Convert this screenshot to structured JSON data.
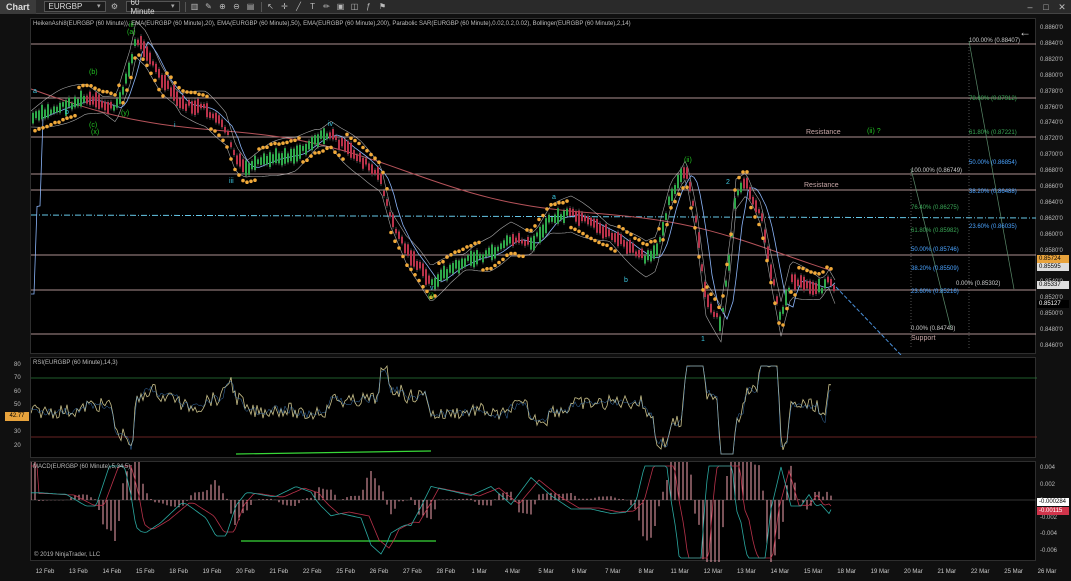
{
  "toolbar": {
    "title": "Chart",
    "instrument": "EURGBP",
    "period": "60 Minute",
    "icons": [
      "bar-type-icon",
      "draw-tools-icon",
      "zoom-in-icon",
      "zoom-out-icon",
      "properties-icon",
      "cursor-icon",
      "crosshair-icon",
      "line-tool-icon",
      "text-tool-icon",
      "pencil-icon",
      "data-box-icon",
      "screenshot-icon",
      "indicators-icon",
      "strategies-icon"
    ],
    "window_controls": [
      "minimize-icon",
      "maximize-icon",
      "close-icon"
    ]
  },
  "price_panel": {
    "indicator_label": "HeikenAshi8(EURGBP (60 Minute)), EMA(EURGBP (60 Minute),20), EMA(EURGBP (60 Minute),50), EMA(EURGBP (60 Minute),200), Parabolic SAR(EURGBP (60 Minute),0.02,0.2,0.02), Bollinger(EURGBP (60 Minute),2,14)",
    "axis_ticks": [
      "0.8860'0",
      "0.8840'0",
      "0.8820'0",
      "0.8800'0",
      "0.8780'0",
      "0.8760'0",
      "0.8740'0",
      "0.8720'0",
      "0.8700'0",
      "0.8680'0",
      "0.8660'0",
      "0.8640'0",
      "0.8620'0",
      "0.8600'0",
      "0.8580'0",
      "0.8560'0",
      "0.8540'0",
      "0.8520'0",
      "0.8500'0",
      "0.8480'0",
      "0.8460'0"
    ],
    "axis_badges": [
      {
        "text": "0.85724",
        "bg": "#e8a33c",
        "fg": "#000000"
      },
      {
        "text": "0.85595",
        "bg": "#dddddd",
        "fg": "#000000"
      },
      {
        "text": "0.85337",
        "bg": "#dddddd",
        "fg": "#000000"
      },
      {
        "text": "0.85127",
        "bg": "#000000",
        "fg": "#ffffff"
      }
    ],
    "fib_labels_right": [
      "100.00% (0.88407)",
      "78.60% (0.87912)",
      "61.80% (0.87221)",
      "50.00% (0.86854)",
      "38.20% (0.86488)",
      "23.60% (0.86035)"
    ],
    "fib_labels_mid": [
      "100.00% (0.86749)",
      "76.40% (0.86275)",
      "61.80% (0.85982)",
      "50.00% (0.85746)",
      "38.20% (0.85509)",
      "23.60% (0.85216)",
      "0.00% (0.84743)",
      "0.00% (0.85302)"
    ],
    "annotations": {
      "resistance_1": "Resistance",
      "resistance_2": "Resistance",
      "support": "Support",
      "wave_question": "(ii) ?"
    },
    "wave_labels": [
      "a",
      "b",
      "c",
      "(b)",
      "(a)",
      "(c)",
      "(x)",
      "iii",
      "(y)",
      "i",
      "ii",
      "iv",
      "v",
      "(i)",
      "(ii)",
      "1",
      "2",
      "b",
      "c",
      "a"
    ]
  },
  "rsi_panel": {
    "indicator_label": "RSI(EURGBP (60 Minute),14,3)",
    "left_ticks": [
      "80",
      "70",
      "60",
      "50",
      "40",
      "30",
      "20"
    ],
    "current_value": "42.77"
  },
  "macd_panel": {
    "indicator_label": "MACD(EURGBP (60 Minute),5,34,5)",
    "axis_ticks": [
      "0.004",
      "0.002",
      "0",
      "-0.002",
      "-0.004",
      "-0.006"
    ],
    "badges": [
      {
        "text": "-0.000284",
        "bg": "#ffffff",
        "fg": "#000000"
      },
      {
        "text": "-0.00115",
        "bg": "#d0344b",
        "fg": "#ffffff"
      }
    ],
    "copyright": "© 2019 NinjaTrader, LLC"
  },
  "x_axis": [
    "12 Feb",
    "13 Feb",
    "14 Feb",
    "15 Feb",
    "18 Feb",
    "19 Feb",
    "20 Feb",
    "21 Feb",
    "22 Feb",
    "25 Feb",
    "26 Feb",
    "27 Feb",
    "28 Feb",
    "1 Mar",
    "4 Mar",
    "5 Mar",
    "6 Mar",
    "7 Mar",
    "8 Mar",
    "11 Mar",
    "12 Mar",
    "13 Mar",
    "14 Mar",
    "15 Mar",
    "18 Mar",
    "19 Mar",
    "20 Mar",
    "21 Mar",
    "22 Mar",
    "25 Mar",
    "26 Mar"
  ],
  "colors": {
    "sar": "#f0a93a",
    "ema": "#8ab4f8",
    "ema200": "#b5535a",
    "bollinger": "#cfcfcf",
    "fib_line": "#d8b4b4",
    "green_label": "#22c022",
    "cyan_label": "#3cc7e0",
    "rsi": "#c9c08a",
    "macd_hist": "#f4a3b0"
  }
}
